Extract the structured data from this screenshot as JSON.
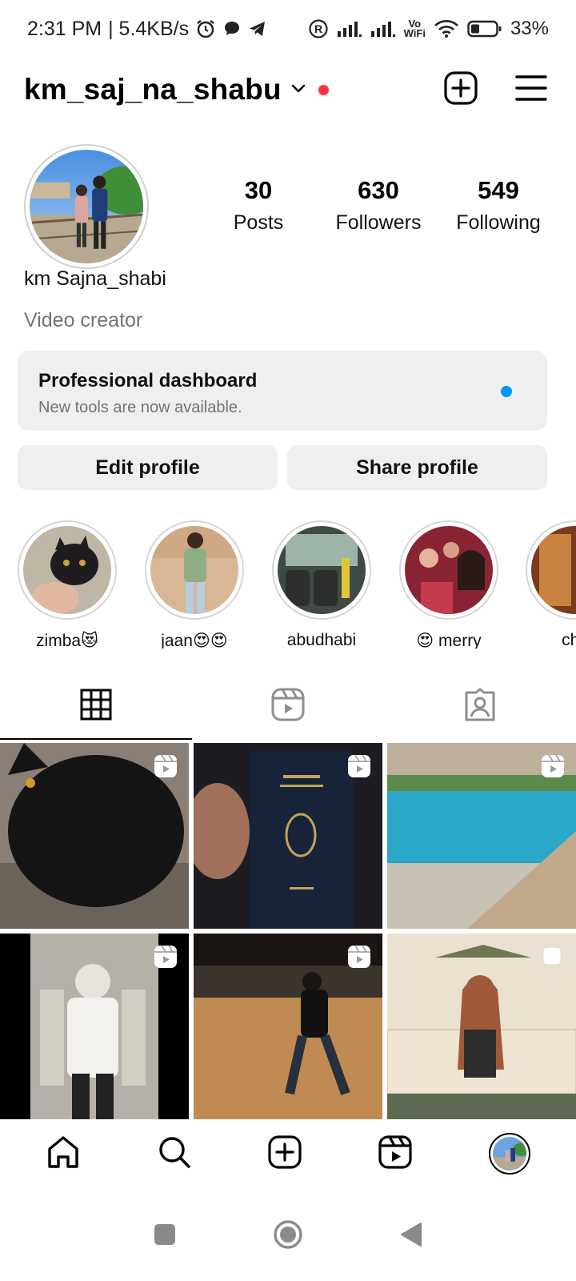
{
  "status_bar": {
    "time": "2:31 PM",
    "net_speed": "| 5.4KB/s",
    "volte_label_top": "Vo",
    "volte_label_bottom": "WiFi",
    "battery": "33%",
    "icons": [
      "alarm-icon",
      "chat-icon",
      "telegram-icon",
      "registered-icon",
      "signal-icon",
      "signal-icon",
      "wifi-icon",
      "battery-icon"
    ]
  },
  "header": {
    "username": "km_saj_na_shabu",
    "icons": [
      "chevron-down-icon",
      "create-icon",
      "menu-icon"
    ]
  },
  "profile": {
    "display_name": "km Sajna_shabi",
    "category": "Video creator",
    "stats": [
      {
        "value": "30",
        "label": "Posts"
      },
      {
        "value": "630",
        "label": "Followers"
      },
      {
        "value": "549",
        "label": "Following"
      }
    ]
  },
  "dashboard": {
    "title": "Professional dashboard",
    "subtitle": "New tools are now available."
  },
  "buttons": {
    "edit": "Edit profile",
    "share": "Share profile"
  },
  "highlights": [
    {
      "label": "zimba😻"
    },
    {
      "label": "jaan😍😍"
    },
    {
      "label": "abudhabi"
    },
    {
      "label": "😍 merry"
    },
    {
      "label": "chu"
    }
  ],
  "tabs": [
    "grid-icon",
    "reels-icon",
    "tagged-icon"
  ],
  "colors": {
    "accent_blue": "#0095f6",
    "notification_red": "#ff3040",
    "button_bg": "#efefef",
    "secondary_text": "#737373"
  }
}
